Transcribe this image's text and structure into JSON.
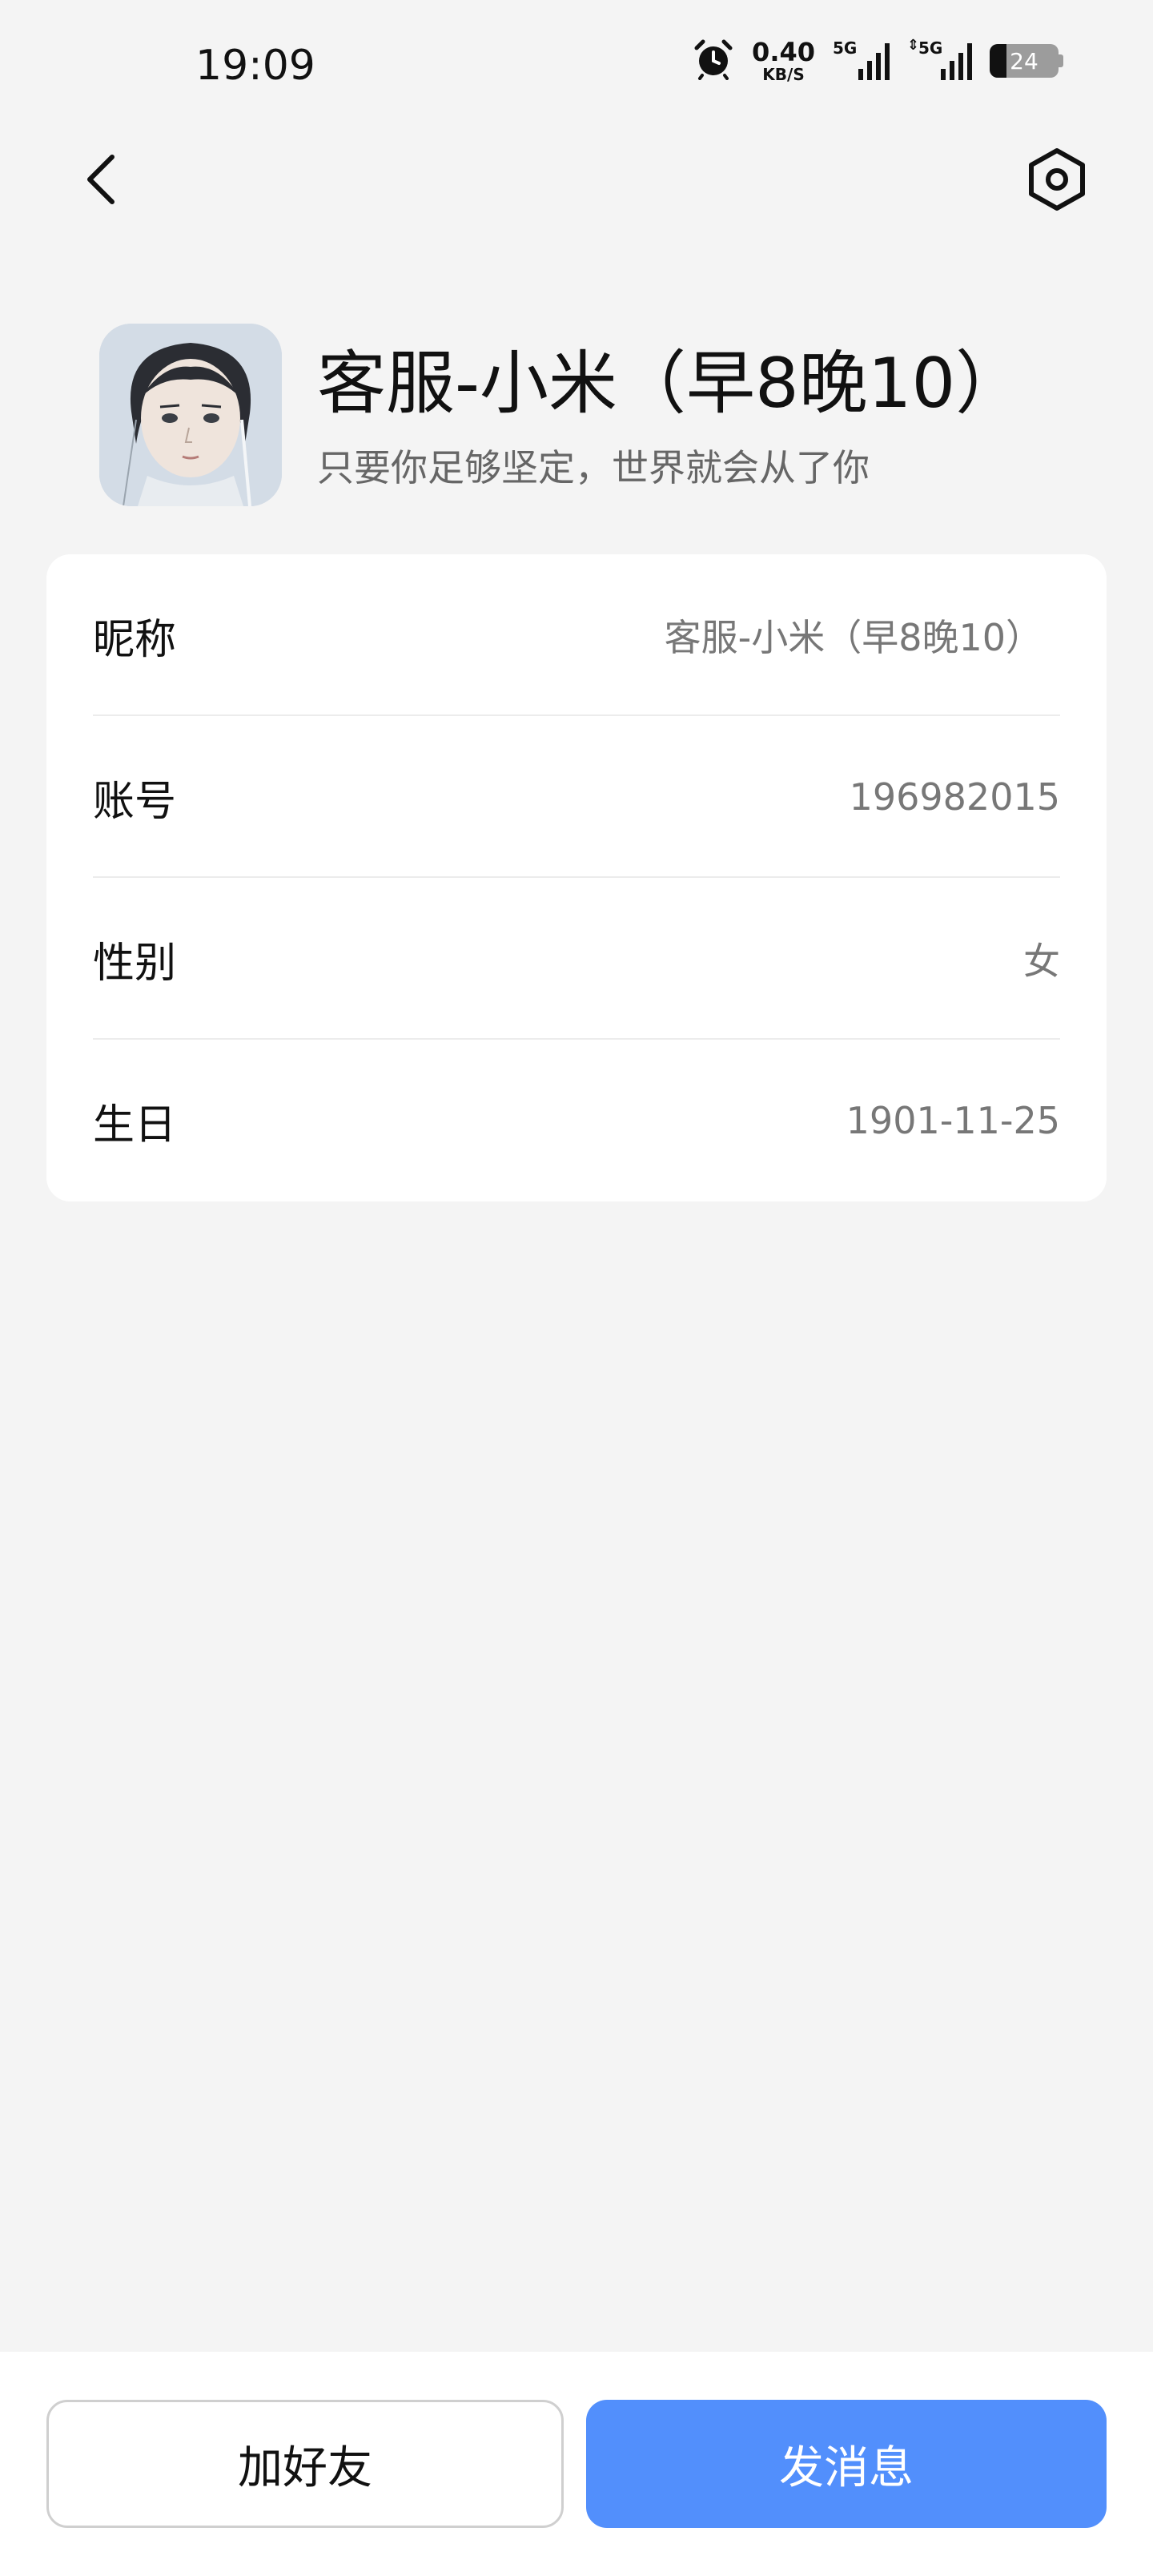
{
  "status_bar": {
    "time": "19:09",
    "net_speed_value": "0.40",
    "net_speed_unit": "KB/S",
    "sim1_label": "5G",
    "sim2_label": "5G",
    "battery_level": "24"
  },
  "header": {
    "back_icon": "chevron-left-icon",
    "settings_icon": "settings-hexagon-icon"
  },
  "profile": {
    "name": "客服-小米（早8晚10）",
    "signature": "只要你足够坚定，世界就会从了你"
  },
  "info": {
    "rows": [
      {
        "label": "昵称",
        "value": "客服-小米（早8晚10）"
      },
      {
        "label": "账号",
        "value": "196982015"
      },
      {
        "label": "性别",
        "value": "女"
      },
      {
        "label": "生日",
        "value": "1901-11-25"
      }
    ]
  },
  "actions": {
    "add_friend_label": "加好友",
    "send_message_label": "发消息"
  },
  "colors": {
    "primary": "#528ffc",
    "background": "#f4f4f4"
  }
}
